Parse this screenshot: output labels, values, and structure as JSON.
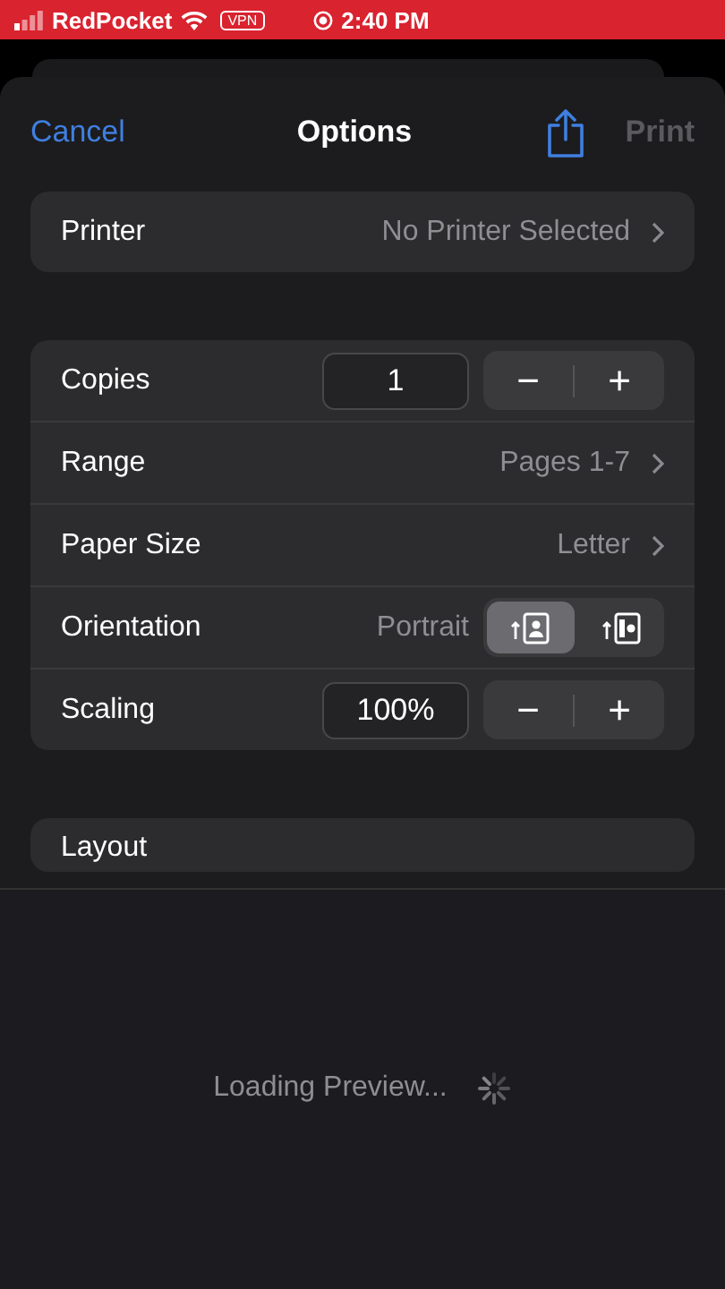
{
  "status_bar": {
    "carrier": "RedPocket",
    "vpn": "VPN",
    "time": "2:40 PM"
  },
  "header": {
    "cancel": "Cancel",
    "title": "Options",
    "print": "Print",
    "print_disabled": true
  },
  "printer": {
    "label": "Printer",
    "value": "No Printer Selected"
  },
  "options": [
    {
      "kind": "stepper",
      "label": "Copies",
      "value": "1",
      "minus": "−",
      "plus": "+"
    },
    {
      "kind": "link",
      "label": "Range",
      "value": "Pages 1-7"
    },
    {
      "kind": "link",
      "label": "Paper Size",
      "value": "Letter"
    },
    {
      "kind": "orientation",
      "label": "Orientation",
      "value": "Portrait",
      "choices": [
        {
          "kind": "portrait",
          "selected": true
        },
        {
          "kind": "landscape",
          "selected": false
        }
      ]
    },
    {
      "kind": "stepper",
      "label": "Scaling",
      "value": "100%",
      "minus": "−",
      "plus": "+"
    }
  ],
  "layout": {
    "label": "Layout"
  },
  "preview": {
    "text": "Loading Preview..."
  }
}
